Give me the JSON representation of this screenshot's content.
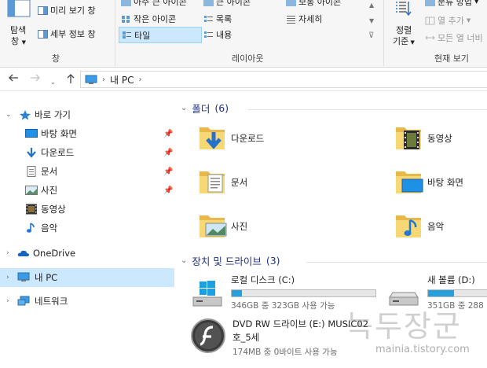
{
  "ribbon": {
    "panes_group_label": "창",
    "layout_group_label": "레이아웃",
    "current_view_group_label": "현재 보기",
    "nav_pane_label_1": "탐색",
    "nav_pane_label_2": "창",
    "preview_pane_label": "미리 보기 창",
    "details_pane_label": "세부 정보 창",
    "layout_items": {
      "extra_large_icons": "아주 큰 아이콘",
      "large_icons": "큰 아이콘",
      "medium_icons": "보통 아이콘",
      "small_icons": "작은 아이콘",
      "list": "목록",
      "details": "자세히",
      "tiles": "타일",
      "content": "내용"
    },
    "sort_by_label_1": "정렬",
    "sort_by_label_2": "기준",
    "group_by_label": "분류 방법",
    "add_columns_label": "열 추가",
    "size_all_columns_label": "모든 열 너비"
  },
  "address": {
    "crumb": "내 PC",
    "back_icon": "arrow-left",
    "forward_icon": "arrow-right",
    "up_icon": "arrow-up"
  },
  "nav_pane": {
    "quick_access": "바로 가기",
    "quick_items": [
      "바탕 화면",
      "다운로드",
      "문서",
      "사진",
      "동영상",
      "음악"
    ],
    "onedrive": "OneDrive",
    "this_pc": "내 PC",
    "network": "네트워크"
  },
  "content": {
    "folders_header": "폴더",
    "folders_count": "(6)",
    "folders": [
      "다운로드",
      "동영상",
      "문서",
      "바탕 화면",
      "사진",
      "음악"
    ],
    "drives_header": "장치 및 드라이브",
    "drives_count": "(3)",
    "drives": [
      {
        "name": "로컬 디스크 (C:)",
        "space": "346GB 중 323GB 사용 가능",
        "used_fraction": 0.07
      },
      {
        "name": "새 볼륨 (D:)",
        "space": "351GB 중 288",
        "used_fraction": 0.18
      },
      {
        "name": "DVD RW 드라이브 (E:) MUSIC02",
        "name_line2": "호_5세",
        "space": "174MB 중 0바이트 사용 가능"
      }
    ]
  },
  "watermark": {
    "text": "녹두장군",
    "url": "mainia.tistory.com"
  },
  "colors": {
    "selection": "#cce8ff",
    "accent_header": "#1e3287",
    "drive_bar": "#26a0da",
    "folder_yellow": "#f8d775"
  }
}
